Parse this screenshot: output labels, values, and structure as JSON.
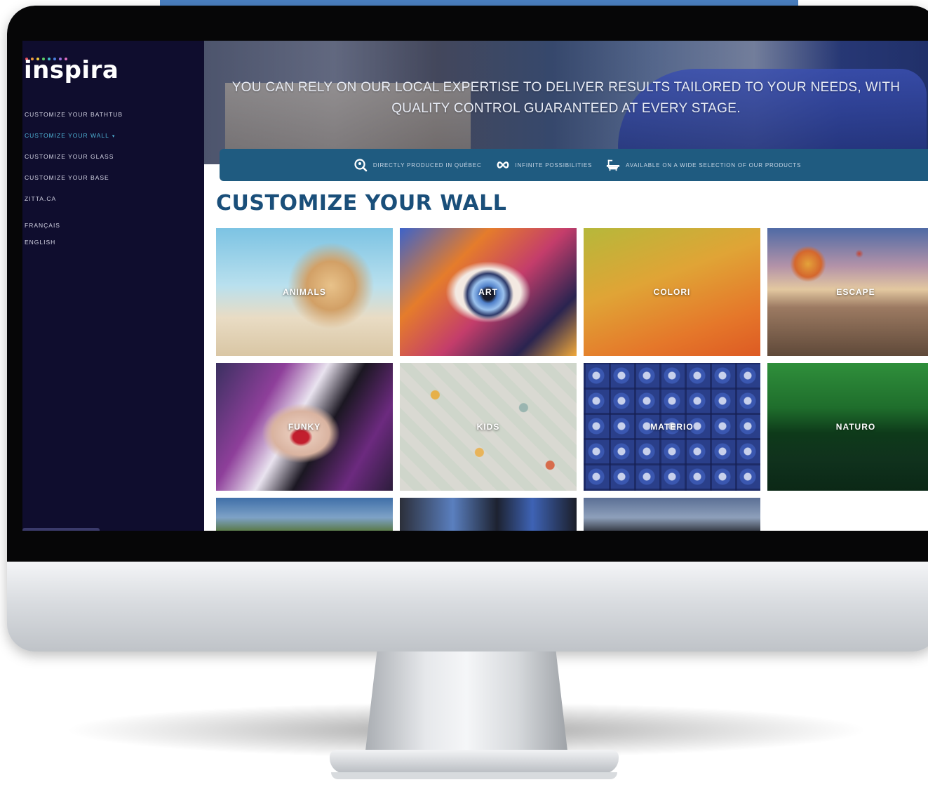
{
  "sidebar": {
    "logo": "inspira",
    "nav": [
      "CUSTOMIZE YOUR BATHTUB",
      "CUSTOMIZE YOUR WALL",
      "CUSTOMIZE YOUR GLASS",
      "CUSTOMIZE YOUR BASE",
      "ZITTA.CA"
    ],
    "languages": [
      "FRANÇAIS",
      "ENGLISH"
    ],
    "active_item": "CUSTOMIZE YOUR WALL"
  },
  "hero": {
    "text": "YOU CAN RELY ON OUR LOCAL EXPERTISE TO DELIVER RESULTS TAILORED TO YOUR NEEDS, WITH QUALITY CONTROL GUARANTEED AT EVERY STAGE."
  },
  "features": [
    {
      "icon": "location-search-icon",
      "label": "DIRECTLY PRODUCED IN QUÉBEC"
    },
    {
      "icon": "infinity-icon",
      "label": "INFINITE POSSIBILITIES"
    },
    {
      "icon": "bathtub-icon",
      "label": "AVAILABLE ON A WIDE SELECTION OF OUR PRODUCTS"
    }
  ],
  "section_title": "CUSTOMIZE YOUR WALL",
  "categories": [
    {
      "label": "ANIMALS"
    },
    {
      "label": "ART"
    },
    {
      "label": "COLORI"
    },
    {
      "label": "ESCAPE"
    },
    {
      "label": "FUNKY"
    },
    {
      "label": "KIDS"
    },
    {
      "label": "MATERIO"
    },
    {
      "label": "NATURO"
    }
  ],
  "colors": {
    "sidebar_bg": "#0f0d2e",
    "accent_active": "#4fb3d6",
    "features_bar": "#1f5b80",
    "title": "#1a4f7a"
  }
}
